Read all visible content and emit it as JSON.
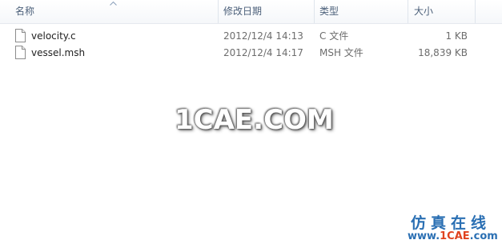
{
  "columns": {
    "name": "名称",
    "date_modified": "修改日期",
    "type": "类型",
    "size": "大小"
  },
  "sort": {
    "column": "name",
    "direction": "ascending",
    "icon": "sort-up-arrow-icon"
  },
  "files": [
    {
      "name": "velocity.c",
      "date_modified": "2012/12/4 14:13",
      "type": "C 文件",
      "size": "1 KB",
      "icon": "file-icon"
    },
    {
      "name": "vessel.msh",
      "date_modified": "2012/12/4 14:17",
      "type": "MSH 文件",
      "size": "18,839 KB",
      "icon": "file-icon"
    }
  ],
  "watermark": {
    "center_text": "1CAE.COM",
    "brand_cn": "仿真在线",
    "brand_url_prefix": "www.",
    "brand_url_accent": "1CAE",
    "brand_url_suffix": ".com"
  },
  "colors": {
    "header_text": "#4c607a",
    "secondary_text": "#6d6d6d",
    "brand_blue": "#2a6fb3",
    "brand_red": "#e0431f"
  }
}
